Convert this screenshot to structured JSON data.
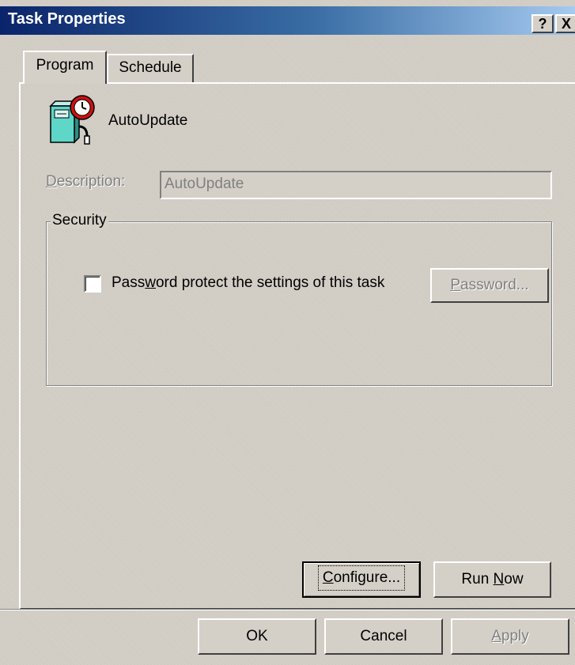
{
  "window": {
    "title": "Task Properties",
    "help_button": "?",
    "close_button": "X"
  },
  "tabs": [
    {
      "label": "Program",
      "active": true
    },
    {
      "label": "Schedule",
      "active": false
    }
  ],
  "task": {
    "icon": "scheduled-task-icon",
    "name": "AutoUpdate"
  },
  "description": {
    "label_underline": "D",
    "label_rest": "escription:",
    "value": "AutoUpdate",
    "enabled": false
  },
  "security": {
    "group_label": "Security",
    "checkbox_pre": "Pass",
    "checkbox_underline": "w",
    "checkbox_post": "ord protect the settings of this task",
    "checked": false,
    "password_button_underline": "P",
    "password_button_rest": "assword...",
    "password_enabled": false
  },
  "actions": {
    "configure_underline": "C",
    "configure_rest": "onfigure...",
    "run_now_pre": "Run ",
    "run_now_underline": "N",
    "run_now_post": "ow"
  },
  "footer": {
    "ok": "OK",
    "cancel": "Cancel",
    "apply_underline": "A",
    "apply_rest": "pply",
    "apply_enabled": false
  },
  "colors": {
    "dialog_face": "#d4d0c8",
    "title_start": "#0a246a",
    "title_end": "#a6caf0",
    "disabled_text": "#808080"
  }
}
